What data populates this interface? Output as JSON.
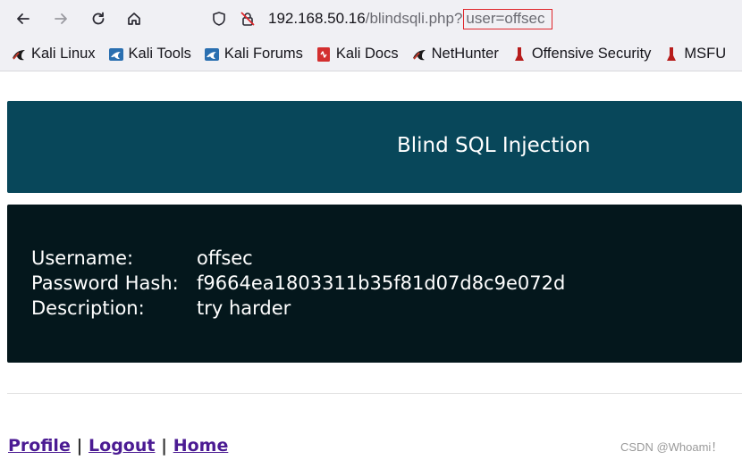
{
  "browser": {
    "url": {
      "host": "192.168.50.16",
      "path": "/blindsqli.php?",
      "query": "user=offsec"
    },
    "bookmarks": [
      {
        "label": "Kali Linux",
        "icon": "kali-dragon-icon"
      },
      {
        "label": "Kali Tools",
        "icon": "kali-dragon-icon"
      },
      {
        "label": "Kali Forums",
        "icon": "kali-dragon-icon"
      },
      {
        "label": "Kali Docs",
        "icon": "kali-docs-icon"
      },
      {
        "label": "NetHunter",
        "icon": "kali-dragon-icon"
      },
      {
        "label": "Offensive Security",
        "icon": "offsec-icon"
      },
      {
        "label": "MSFU",
        "icon": "offsec-icon"
      }
    ]
  },
  "page": {
    "banner_title": "Blind SQL Injection",
    "details": {
      "username_label": "Username:",
      "username_value": "offsec",
      "hash_label": "Password Hash:",
      "hash_value": "f9664ea1803311b35f81d07d8c9e072d",
      "description_label": "Description:",
      "description_value": "try harder"
    },
    "links": {
      "profile": "Profile",
      "logout": "Logout",
      "home": "Home",
      "separator": "|"
    }
  },
  "watermark": "CSDN @Whoami！",
  "colors": {
    "banner_bg": "#08475a",
    "panel_bg": "#04171c",
    "link": "#4b1b93",
    "highlight_box": "#e0262b"
  }
}
